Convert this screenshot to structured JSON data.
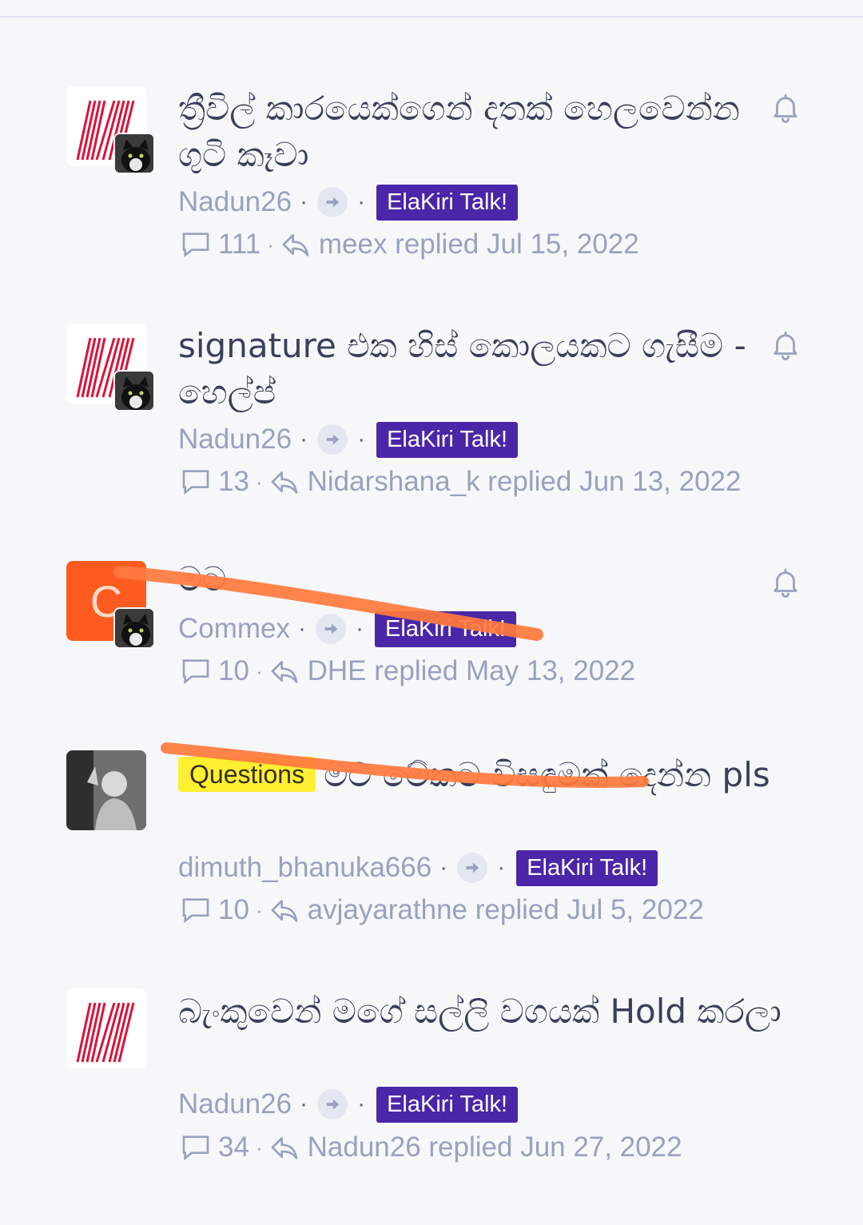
{
  "threads": [
    {
      "title": "ත්‍රීවිල් කාරයෙක්ගෙන් දතක් හෙලවෙන්න ගුටි කෑවා",
      "author": "Nadun26",
      "forum": "ElaKiri Talk!",
      "replies": "111",
      "last_reply": "meex replied Jul 15, 2022"
    },
    {
      "title": "signature එක හිස් කොලයකට ගැසීම - හෙල්ප්",
      "author": "Nadun26",
      "forum": "ElaKiri Talk!",
      "replies": "13",
      "last_reply": "Nidarshana_k replied Jun 13, 2022"
    },
    {
      "title": "මට",
      "author": "Commex",
      "avatar_letter": "C",
      "forum": "ElaKiri Talk!",
      "replies": "10",
      "last_reply": "DHE replied May 13, 2022"
    },
    {
      "prefix": "Questions",
      "title": "මට මේකට විසඳුමක් දෙන්න pls",
      "author": "dimuth_bhanuka666",
      "forum": "ElaKiri Talk!",
      "replies": "10",
      "last_reply": "avjayarathne replied Jul 5, 2022"
    },
    {
      "title": "බැංකුවෙන් මගේ සල්ලි වගයක් Hold කරලා",
      "author": "Nadun26",
      "forum": "ElaKiri Talk!",
      "replies": "34",
      "last_reply": "Nadun26 replied Jun 27, 2022"
    }
  ],
  "icons": {
    "bell": "bell-icon",
    "arrow": "arrow-right-icon",
    "replies": "comment-icon",
    "last_reply": "reply-icon"
  },
  "colors": {
    "forum_badge": "#4b26a8",
    "prefix_badge": "#ffef32",
    "meta_text": "#98a2bf",
    "title_text": "#38405a",
    "scribble": "#ff7a3d"
  }
}
